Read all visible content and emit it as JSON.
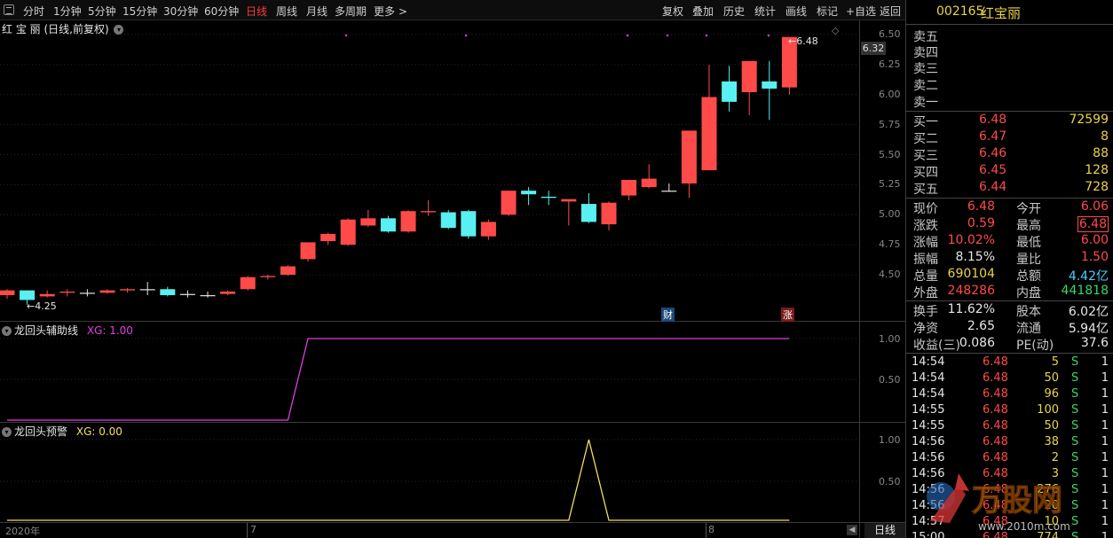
{
  "toolbar": {
    "left_items": [
      "分时",
      "1分钟",
      "5分钟",
      "15分钟",
      "30分钟",
      "60分钟",
      "日线",
      "周线",
      "月线",
      "多周期",
      "更多 >"
    ],
    "active": "日线",
    "right_items": [
      "复权",
      "叠加",
      "历史",
      "统计",
      "画线",
      "标记",
      "+自选",
      "返回"
    ]
  },
  "stock": {
    "code": "002165",
    "name": "红宝丽"
  },
  "main_chart": {
    "title": "红 宝 丽 (日线,前复权)",
    "high_label": "6.48",
    "low_label": "4.25",
    "current_tag": "6.32",
    "y_ticks": [
      "6.50",
      "6.25",
      "6.00",
      "5.75",
      "5.50",
      "5.25",
      "5.00",
      "4.75",
      "4.50"
    ],
    "badges": {
      "cai": "财",
      "zhang": "涨"
    },
    "up_color": "#ff4a4a",
    "down_color": "#58f0f0"
  },
  "indicator1": {
    "title": "龙回头辅助线",
    "value_label": "XG: 1.00",
    "y_ticks": [
      "1.00",
      "0.50"
    ],
    "color": "#e040e0"
  },
  "indicator2": {
    "title": "龙回头预警",
    "value_label": "XG: 0.00",
    "y_ticks": [
      "1.00",
      "0.50"
    ],
    "color": "#f0e060"
  },
  "x_axis": {
    "labels": [
      "2020年",
      "7",
      "8"
    ],
    "period": "日线"
  },
  "chart_data": {
    "type": "candlestick",
    "ohlc": [
      [
        4.33,
        4.38,
        4.3,
        4.37
      ],
      [
        4.37,
        4.37,
        4.25,
        4.29
      ],
      [
        4.32,
        4.37,
        4.31,
        4.34
      ],
      [
        4.35,
        4.38,
        4.32,
        4.36
      ],
      [
        4.35,
        4.38,
        4.32,
        4.35
      ],
      [
        4.35,
        4.38,
        4.34,
        4.37
      ],
      [
        4.37,
        4.39,
        4.35,
        4.38
      ],
      [
        4.38,
        4.44,
        4.33,
        4.38
      ],
      [
        4.38,
        4.4,
        4.32,
        4.33
      ],
      [
        4.34,
        4.37,
        4.31,
        4.34
      ],
      [
        4.33,
        4.36,
        4.31,
        4.33
      ],
      [
        4.34,
        4.37,
        4.33,
        4.36
      ],
      [
        4.38,
        4.49,
        4.37,
        4.48
      ],
      [
        4.48,
        4.5,
        4.46,
        4.49
      ],
      [
        4.5,
        4.58,
        4.49,
        4.57
      ],
      [
        4.63,
        4.7,
        4.61,
        4.77
      ],
      [
        4.78,
        4.85,
        4.75,
        4.84
      ],
      [
        4.75,
        4.97,
        4.74,
        4.96
      ],
      [
        4.91,
        5.04,
        4.9,
        4.97
      ],
      [
        4.97,
        4.99,
        4.85,
        4.86
      ],
      [
        4.86,
        5.04,
        4.85,
        5.03
      ],
      [
        5.02,
        5.12,
        4.99,
        5.03
      ],
      [
        5.02,
        5.04,
        4.88,
        4.89
      ],
      [
        5.03,
        5.04,
        4.8,
        4.82
      ],
      [
        4.82,
        4.96,
        4.79,
        4.94
      ],
      [
        5.0,
        5.2,
        4.99,
        5.2
      ],
      [
        5.2,
        5.23,
        5.08,
        5.17
      ],
      [
        5.15,
        5.2,
        5.08,
        5.14
      ],
      [
        5.11,
        5.13,
        4.91,
        5.13
      ],
      [
        5.09,
        5.18,
        4.93,
        4.94
      ],
      [
        4.92,
        5.11,
        4.87,
        5.1
      ],
      [
        5.16,
        5.29,
        5.12,
        5.29
      ],
      [
        5.23,
        5.42,
        5.22,
        5.3
      ],
      [
        5.2,
        5.26,
        5.19,
        5.2
      ],
      [
        5.26,
        5.7,
        5.14,
        5.7
      ],
      [
        5.37,
        6.25,
        5.62,
        5.98
      ],
      [
        6.11,
        6.24,
        5.86,
        5.94
      ],
      [
        6.02,
        6.27,
        5.83,
        6.28
      ],
      [
        6.11,
        6.28,
        5.79,
        6.05
      ],
      [
        6.06,
        6.48,
        6.0,
        6.48
      ]
    ],
    "indicator1_values": [
      0,
      0,
      0,
      0,
      0,
      0,
      0,
      0,
      0,
      0,
      0,
      0,
      0,
      0,
      0,
      1,
      1,
      1,
      1,
      1,
      1,
      1,
      1,
      1,
      1,
      1,
      1,
      1,
      1,
      1,
      1,
      1,
      1,
      1,
      1,
      1,
      1,
      1,
      1,
      1
    ],
    "indicator2_values": [
      0,
      0,
      0,
      0,
      0,
      0,
      0,
      0,
      0,
      0,
      0,
      0,
      0,
      0,
      0,
      0,
      0,
      0,
      0,
      0,
      0,
      0,
      0,
      0,
      0,
      0,
      0,
      0,
      0,
      1,
      0,
      0,
      0,
      0,
      0,
      0,
      0,
      0,
      0,
      0
    ]
  },
  "order_book": {
    "sell": [
      {
        "label": "卖五",
        "price": "",
        "vol": ""
      },
      {
        "label": "卖四",
        "price": "",
        "vol": ""
      },
      {
        "label": "卖三",
        "price": "",
        "vol": ""
      },
      {
        "label": "卖二",
        "price": "",
        "vol": ""
      },
      {
        "label": "卖一",
        "price": "",
        "vol": ""
      }
    ],
    "buy": [
      {
        "label": "买一",
        "price": "6.48",
        "vol": "72599"
      },
      {
        "label": "买二",
        "price": "6.47",
        "vol": "8"
      },
      {
        "label": "买三",
        "price": "6.46",
        "vol": "88"
      },
      {
        "label": "买四",
        "price": "6.45",
        "vol": "128"
      },
      {
        "label": "买五",
        "price": "6.44",
        "vol": "728"
      }
    ]
  },
  "quote": [
    {
      "l1": "现价",
      "v1": "6.48",
      "c1": "red",
      "l2": "今开",
      "v2": "6.06",
      "c2": "red"
    },
    {
      "l1": "涨跌",
      "v1": "0.59",
      "c1": "red",
      "l2": "最高",
      "v2": "6.48",
      "c2": "red"
    },
    {
      "l1": "涨幅",
      "v1": "10.02%",
      "c1": "red",
      "l2": "最低",
      "v2": "6.00",
      "c2": "red"
    },
    {
      "l1": "振幅",
      "v1": "8.15%",
      "c1": "white",
      "l2": "量比",
      "v2": "1.50",
      "c2": "red"
    },
    {
      "l1": "总量",
      "v1": "690104",
      "c1": "yellow",
      "l2": "总额",
      "v2": "4.42亿",
      "c2": "cyan"
    },
    {
      "l1": "外盘",
      "v1": "248286",
      "c1": "red",
      "l2": "内盘",
      "v2": "441818",
      "c2": "green"
    }
  ],
  "finance": [
    {
      "l1": "换手",
      "v1": "11.62%",
      "l2": "股本",
      "v2": "6.02亿"
    },
    {
      "l1": "净资",
      "v1": "2.65",
      "l2": "流通",
      "v2": "5.94亿"
    },
    {
      "l1": "收益(三)",
      "v1": "0.086",
      "l2": "PE(动)",
      "v2": "37.6"
    }
  ],
  "ticks": [
    {
      "time": "14:54",
      "price": "6.48",
      "vol": "5",
      "dir": "S",
      "n": "1"
    },
    {
      "time": "14:54",
      "price": "6.48",
      "vol": "50",
      "dir": "S",
      "n": "1"
    },
    {
      "time": "14:54",
      "price": "6.48",
      "vol": "96",
      "dir": "S",
      "n": "1"
    },
    {
      "time": "14:55",
      "price": "6.48",
      "vol": "100",
      "dir": "S",
      "n": "1"
    },
    {
      "time": "14:55",
      "price": "6.48",
      "vol": "50",
      "dir": "S",
      "n": "1"
    },
    {
      "time": "14:56",
      "price": "6.48",
      "vol": "38",
      "dir": "S",
      "n": "1"
    },
    {
      "time": "14:56",
      "price": "6.48",
      "vol": "2",
      "dir": "S",
      "n": "1"
    },
    {
      "time": "14:56",
      "price": "6.48",
      "vol": "3",
      "dir": "S",
      "n": "1"
    },
    {
      "time": "14:56",
      "price": "6.48",
      "vol": "276",
      "dir": "S",
      "n": "1"
    },
    {
      "time": "14:56",
      "price": "6.48",
      "vol": "20",
      "dir": "S",
      "n": "1"
    },
    {
      "time": "14:57",
      "price": "6.48",
      "vol": "10",
      "dir": "S",
      "n": "1"
    },
    {
      "time": "15:00",
      "price": "6.48",
      "vol": "774",
      "dir": "S",
      "n": "1"
    }
  ],
  "watermark": {
    "text": "万股网",
    "url": "www.2010m.com"
  }
}
